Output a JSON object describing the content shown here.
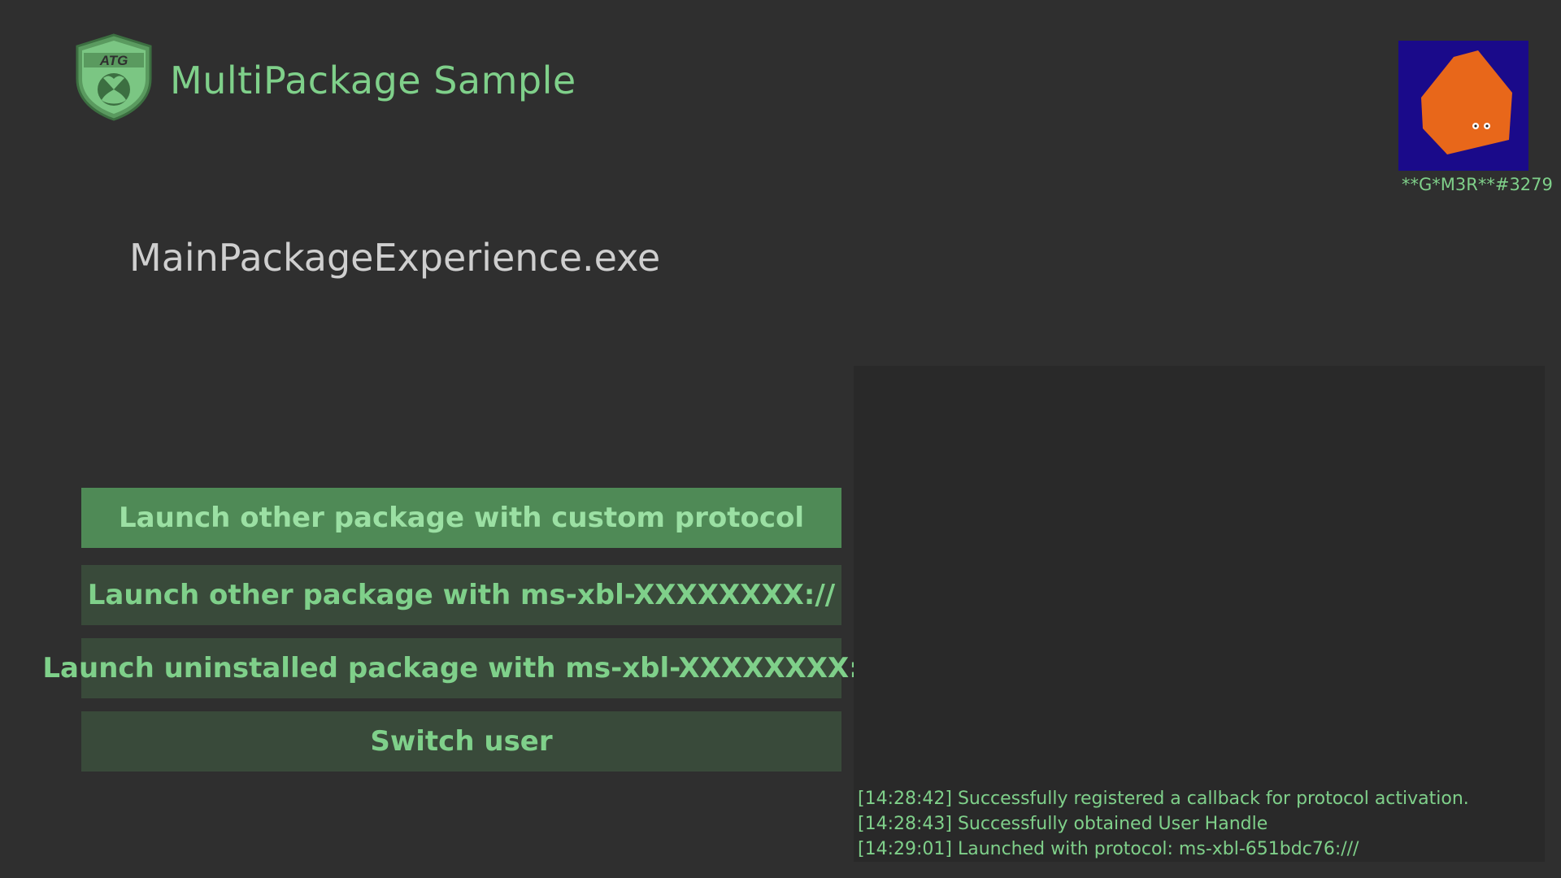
{
  "header": {
    "app_title": "MultiPackage Sample",
    "logo_text": "ATG"
  },
  "exe_label": "MainPackageExperience.exe",
  "user": {
    "gamertag": "**G*M3R**#3279",
    "avatar_bg": "#1a0a8a",
    "avatar_shape_color": "#e8671a"
  },
  "menu": {
    "items": [
      {
        "label": "Launch other package with custom protocol",
        "selected": true
      },
      {
        "label": "Launch other package with ms-xbl-XXXXXXXX://",
        "selected": false
      },
      {
        "label": "Launch uninstalled package with ms-xbl-XXXXXXXX://",
        "selected": false
      },
      {
        "label": "Switch user",
        "selected": false
      }
    ]
  },
  "log": {
    "lines": [
      "[14:28:42] Successfully registered a callback for protocol activation.",
      "[14:28:43] Successfully obtained User Handle",
      "[14:29:01] Launched with protocol: ms-xbl-651bdc76:///"
    ]
  },
  "colors": {
    "background": "#2f2f2f",
    "accent_green": "#7fd08a",
    "button_bg": "#394a3a",
    "button_selected_bg": "#4f8a56",
    "log_bg": "#292929"
  }
}
